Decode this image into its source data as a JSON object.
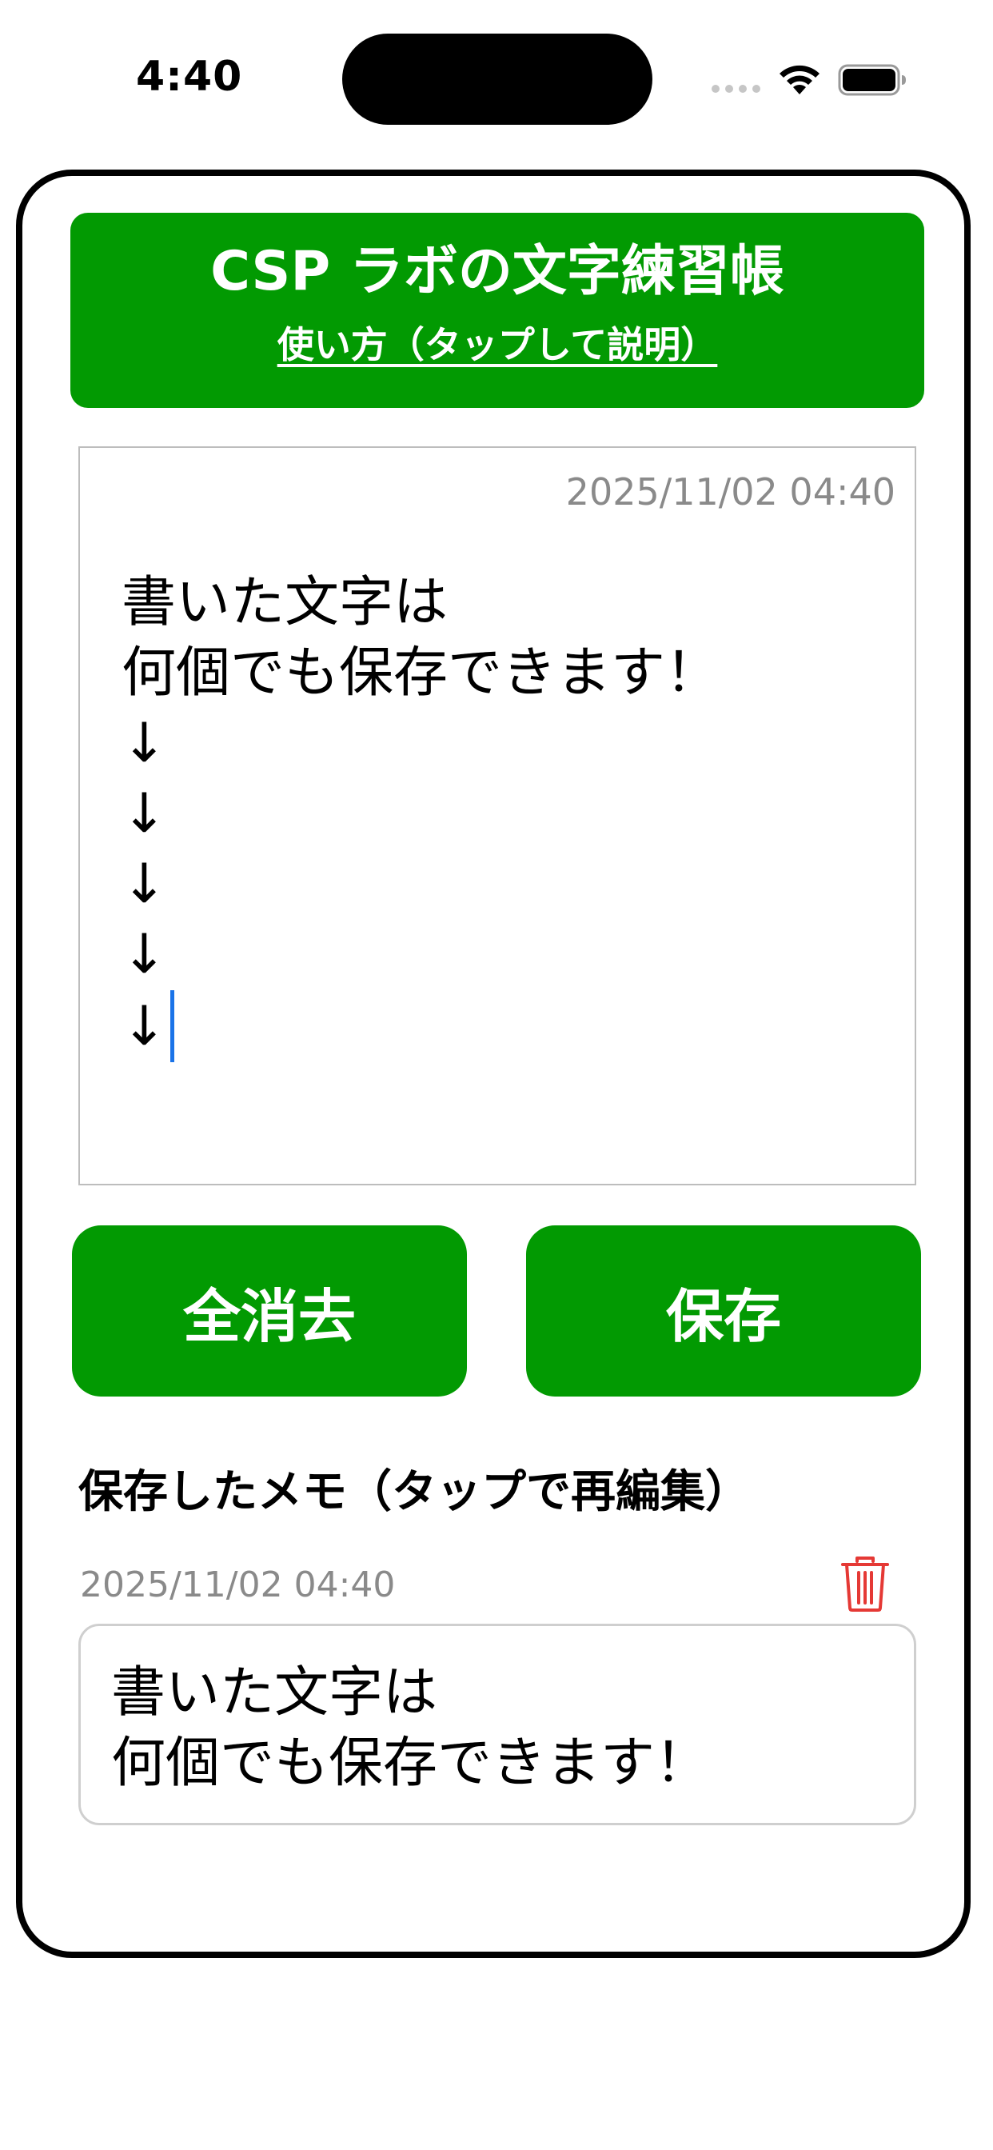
{
  "status_bar": {
    "time": "4:40",
    "icons": [
      "signal-dots-icon",
      "wifi-icon",
      "battery-icon"
    ]
  },
  "header": {
    "title": "CSP ラボの文字練習帳",
    "help_link": "使い方（タップして説明）"
  },
  "editor": {
    "timestamp": "2025/11/02 04:40",
    "text": "書いた文字は\n何個でも保存できます！\n↓\n↓\n↓\n↓\n↓"
  },
  "buttons": {
    "clear_all": "全消去",
    "save": "保存"
  },
  "saved": {
    "section_title": "保存したメモ（タップで再編集）",
    "memos": [
      {
        "timestamp": "2025/11/02 04:40",
        "text": "書いた文字は\n何個でも保存できます！",
        "delete_icon": "trash-icon"
      }
    ]
  },
  "colors": {
    "accent_green": "#029a02",
    "timestamp_gray": "#8a8a8a",
    "delete_red": "#e53935",
    "caret_blue": "#1a73e8"
  }
}
